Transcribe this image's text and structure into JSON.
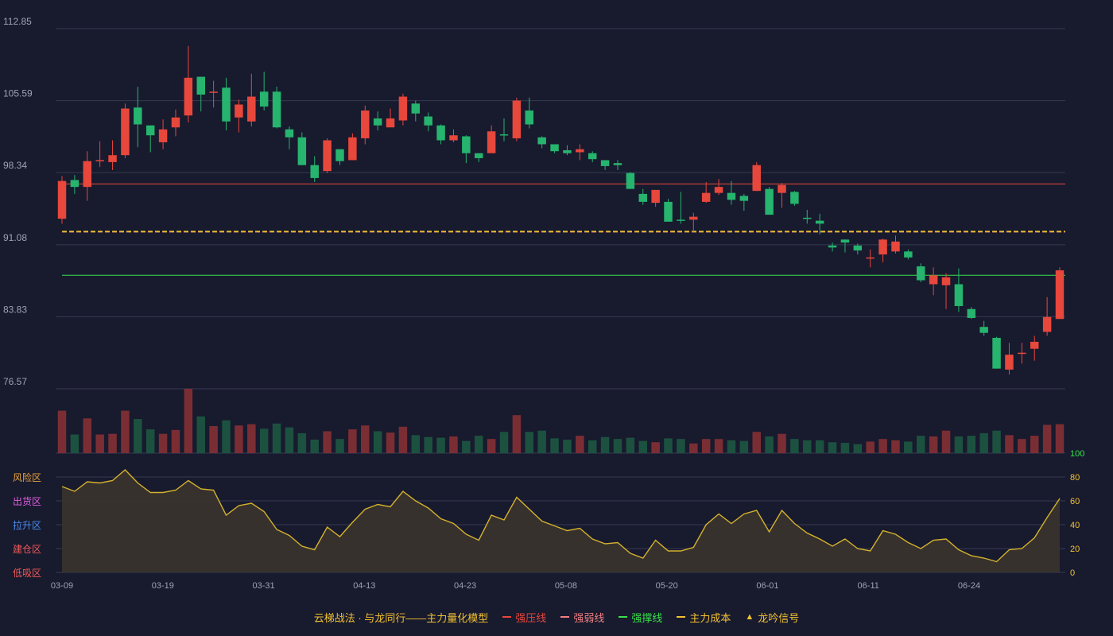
{
  "colors": {
    "background": "#181a2e",
    "up": "#e8473c",
    "down": "#26b46e",
    "up_volume": "#7a2e33",
    "down_volume": "#1c5140",
    "grid": "#363a52",
    "axis_text": "#9ea1b3",
    "resistance": "#e8473c",
    "weak": "#f08080",
    "support": "#37e04a",
    "cost": "#f2c230",
    "oscillator": "#d4b22c",
    "oscillator_fill": "#3b342d"
  },
  "chart_data": {
    "type": "candlestick",
    "x_tick_labels": [
      "03-09",
      "03-19",
      "03-31",
      "04-13",
      "04-23",
      "05-08",
      "05-20",
      "06-01",
      "06-11",
      "06-24"
    ],
    "price_axis": {
      "min": 76.57,
      "max": 112.85,
      "ticks": [
        112.85,
        105.59,
        98.34,
        91.08,
        83.83,
        76.57
      ]
    },
    "oscillator_axis": {
      "min": 0,
      "max": 100,
      "ticks": [
        100,
        80,
        60,
        40,
        20,
        0
      ]
    },
    "zones": [
      {
        "label": "风险区",
        "value": 80,
        "color": "#e8a33c"
      },
      {
        "label": "出货区",
        "value": 60,
        "color": "#e060e0"
      },
      {
        "label": "拉升区",
        "value": 40,
        "color": "#4a8ef0"
      },
      {
        "label": "建仓区",
        "value": 20,
        "color": "#ef5a5a"
      },
      {
        "label": "低吸区",
        "value": 0,
        "color": "#ef5a5a"
      }
    ],
    "lines": {
      "resistance": 97.2,
      "cost": 92.4,
      "support": 88.0
    },
    "candles": [
      [
        93.7,
        97.5,
        93.2,
        98.0,
        66
      ],
      [
        97.6,
        96.9,
        96.2,
        98.1,
        29
      ],
      [
        96.9,
        99.5,
        95.5,
        100.5,
        54
      ],
      [
        99.5,
        99.6,
        98.9,
        101.5,
        29
      ],
      [
        99.4,
        100.1,
        98.6,
        101.6,
        30
      ],
      [
        100.1,
        104.8,
        99.8,
        105.3,
        66
      ],
      [
        104.9,
        103.2,
        100.9,
        107.0,
        53
      ],
      [
        103.1,
        102.1,
        100.4,
        103.1,
        37
      ],
      [
        101.4,
        102.7,
        100.7,
        103.7,
        30
      ],
      [
        102.9,
        103.9,
        102.0,
        104.7,
        36
      ],
      [
        104.1,
        107.9,
        103.4,
        111.1,
        100
      ],
      [
        108.0,
        106.2,
        104.5,
        108.0,
        57
      ],
      [
        106.5,
        106.5,
        104.9,
        107.6,
        42
      ],
      [
        106.9,
        103.5,
        102.6,
        107.9,
        51
      ],
      [
        103.9,
        105.2,
        102.4,
        105.7,
        43
      ],
      [
        103.5,
        106.0,
        103.0,
        108.3,
        45
      ],
      [
        106.5,
        105.0,
        104.6,
        108.5,
        38
      ],
      [
        106.5,
        102.9,
        102.8,
        107.0,
        46
      ],
      [
        102.7,
        101.9,
        100.7,
        103.0,
        40
      ],
      [
        101.9,
        99.1,
        99.1,
        102.4,
        31
      ],
      [
        99.1,
        97.8,
        97.4,
        100.0,
        21
      ],
      [
        98.5,
        101.6,
        98.3,
        101.8,
        34
      ],
      [
        100.7,
        99.5,
        99.1,
        100.7,
        22
      ],
      [
        99.6,
        101.9,
        99.6,
        102.3,
        37
      ],
      [
        101.8,
        104.6,
        101.2,
        105.1,
        43
      ],
      [
        103.8,
        103.1,
        102.6,
        104.5,
        34
      ],
      [
        102.9,
        103.8,
        103.0,
        104.8,
        32
      ],
      [
        103.6,
        106.0,
        103.1,
        106.3,
        41
      ],
      [
        105.3,
        104.3,
        103.5,
        105.6,
        28
      ],
      [
        104.0,
        103.1,
        102.5,
        104.4,
        25
      ],
      [
        103.1,
        101.6,
        101.2,
        103.2,
        24
      ],
      [
        101.6,
        102.1,
        101.4,
        102.7,
        26
      ],
      [
        102.0,
        100.3,
        99.3,
        102.1,
        19
      ],
      [
        100.3,
        99.8,
        99.4,
        100.3,
        27
      ],
      [
        100.3,
        102.5,
        100.4,
        103.1,
        22
      ],
      [
        102.2,
        102.1,
        101.5,
        103.8,
        33
      ],
      [
        101.8,
        105.6,
        101.5,
        105.9,
        59
      ],
      [
        104.6,
        103.2,
        102.8,
        105.9,
        33
      ],
      [
        101.9,
        101.2,
        100.8,
        102.0,
        35
      ],
      [
        101.2,
        100.5,
        100.3,
        101.1,
        23
      ],
      [
        100.6,
        100.3,
        100.1,
        101.1,
        21
      ],
      [
        100.4,
        100.7,
        99.6,
        101.2,
        27
      ],
      [
        100.3,
        99.7,
        99.4,
        100.5,
        20
      ],
      [
        99.6,
        99.0,
        98.6,
        99.6,
        25
      ],
      [
        99.3,
        99.1,
        98.6,
        99.6,
        22
      ],
      [
        98.3,
        96.7,
        96.7,
        98.4,
        24
      ],
      [
        96.2,
        95.4,
        95.1,
        96.7,
        19
      ],
      [
        95.3,
        96.6,
        94.9,
        96.6,
        17
      ],
      [
        95.4,
        93.4,
        93.6,
        95.7,
        23
      ],
      [
        93.6,
        93.5,
        93.2,
        96.4,
        22
      ],
      [
        93.6,
        93.9,
        92.4,
        94.3,
        15
      ],
      [
        95.4,
        96.3,
        95.3,
        97.4,
        22
      ],
      [
        96.3,
        96.9,
        96.1,
        97.7,
        22
      ],
      [
        96.3,
        95.6,
        95.1,
        97.5,
        20
      ],
      [
        96.0,
        95.5,
        94.5,
        96.2,
        19
      ],
      [
        96.5,
        99.1,
        96.5,
        99.4,
        33
      ],
      [
        96.7,
        94.1,
        94.1,
        96.9,
        26
      ],
      [
        96.3,
        97.1,
        94.8,
        97.3,
        30
      ],
      [
        96.4,
        95.2,
        95.0,
        96.5,
        22
      ],
      [
        93.8,
        93.7,
        93.2,
        94.6,
        20
      ],
      [
        93.5,
        93.2,
        92.1,
        94.2,
        20
      ],
      [
        91.0,
        90.8,
        90.4,
        91.3,
        17
      ],
      [
        91.6,
        91.3,
        90.3,
        91.6,
        16
      ],
      [
        91.0,
        90.5,
        90.1,
        91.2,
        14
      ],
      [
        89.7,
        89.8,
        88.8,
        90.6,
        18
      ],
      [
        90.1,
        91.6,
        89.3,
        91.7,
        22
      ],
      [
        90.4,
        91.4,
        90.2,
        92.0,
        20
      ],
      [
        90.4,
        89.8,
        89.6,
        90.6,
        18
      ],
      [
        88.9,
        87.5,
        87.3,
        89.2,
        27
      ],
      [
        87.1,
        88.0,
        86.0,
        88.8,
        26
      ],
      [
        87.0,
        87.8,
        84.6,
        88.2,
        35
      ],
      [
        87.1,
        84.9,
        84.3,
        88.7,
        26
      ],
      [
        84.6,
        83.7,
        83.6,
        84.8,
        27
      ],
      [
        82.8,
        82.2,
        81.9,
        83.4,
        31
      ],
      [
        81.7,
        78.6,
        78.6,
        81.8,
        35
      ],
      [
        78.5,
        80.0,
        78.0,
        81.2,
        28
      ],
      [
        80.1,
        80.2,
        79.1,
        81.2,
        22
      ],
      [
        80.6,
        81.3,
        79.4,
        81.9,
        27
      ],
      [
        82.3,
        83.8,
        81.9,
        85.8,
        44
      ],
      [
        83.6,
        88.5,
        83.6,
        88.8,
        45
      ]
    ],
    "oscillator": [
      72,
      68,
      76,
      75,
      77,
      86,
      75,
      67,
      67,
      69,
      77,
      70,
      69,
      48,
      56,
      58,
      51,
      36,
      31,
      22,
      19,
      38,
      30,
      42,
      53,
      57,
      55,
      68,
      60,
      54,
      45,
      41,
      32,
      27,
      48,
      44,
      63,
      53,
      43,
      39,
      35,
      37,
      28,
      24,
      25,
      16,
      12,
      27,
      18,
      18,
      21,
      40,
      49,
      41,
      49,
      52,
      34,
      52,
      41,
      33,
      28,
      22,
      28,
      20,
      18,
      35,
      32,
      25,
      20,
      27,
      28,
      19,
      14,
      12,
      9,
      19,
      20,
      29,
      46,
      62
    ]
  },
  "legend": {
    "title": "云梯战法 · 与龙同行——主力量化模型",
    "items": [
      {
        "label": "强压线",
        "color": "#e8473c",
        "style": "solid"
      },
      {
        "label": "强弱线",
        "color": "#f08080",
        "style": "dashed"
      },
      {
        "label": "强撑线",
        "color": "#37e04a",
        "style": "solid"
      },
      {
        "label": "主力成本",
        "color": "#f2c230",
        "style": "dashed"
      },
      {
        "label": "龙吟信号",
        "color": "#f2c230",
        "style": "triangle",
        "symbol": "▲"
      }
    ]
  }
}
